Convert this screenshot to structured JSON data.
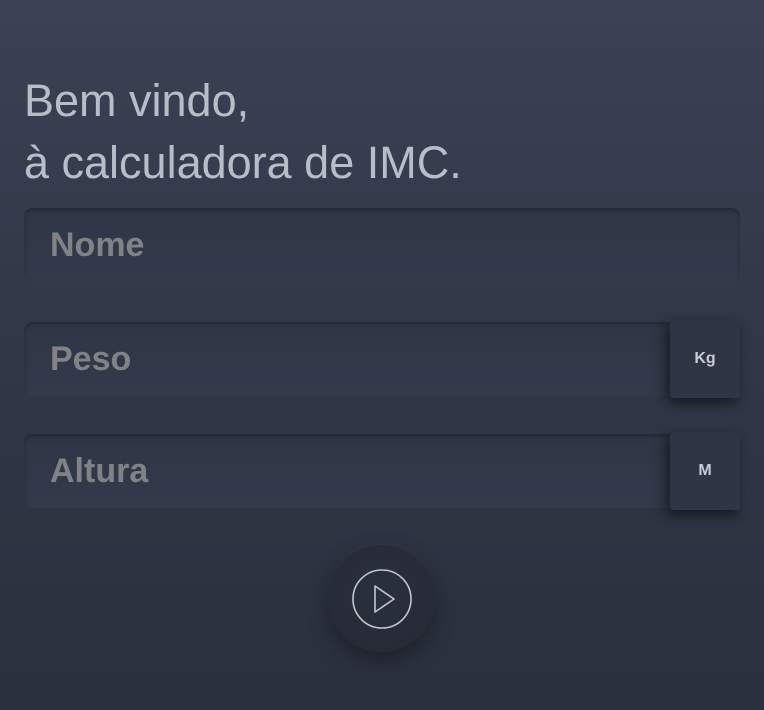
{
  "header": {
    "line1": "Bem vindo,",
    "line2": "à calculadora de IMC."
  },
  "form": {
    "name": {
      "placeholder": "Nome",
      "value": ""
    },
    "weight": {
      "placeholder": "Peso",
      "value": "",
      "unit": "Kg"
    },
    "height": {
      "placeholder": "Altura",
      "value": "",
      "unit": "M"
    },
    "submit": {
      "icon": "play-circle-icon"
    }
  },
  "colors": {
    "background_top": "#3a4254",
    "background_bottom": "#2a303d",
    "heading_text": "#b9bdc7",
    "placeholder_text": "#808286",
    "unit_text": "#c8ccd4"
  }
}
